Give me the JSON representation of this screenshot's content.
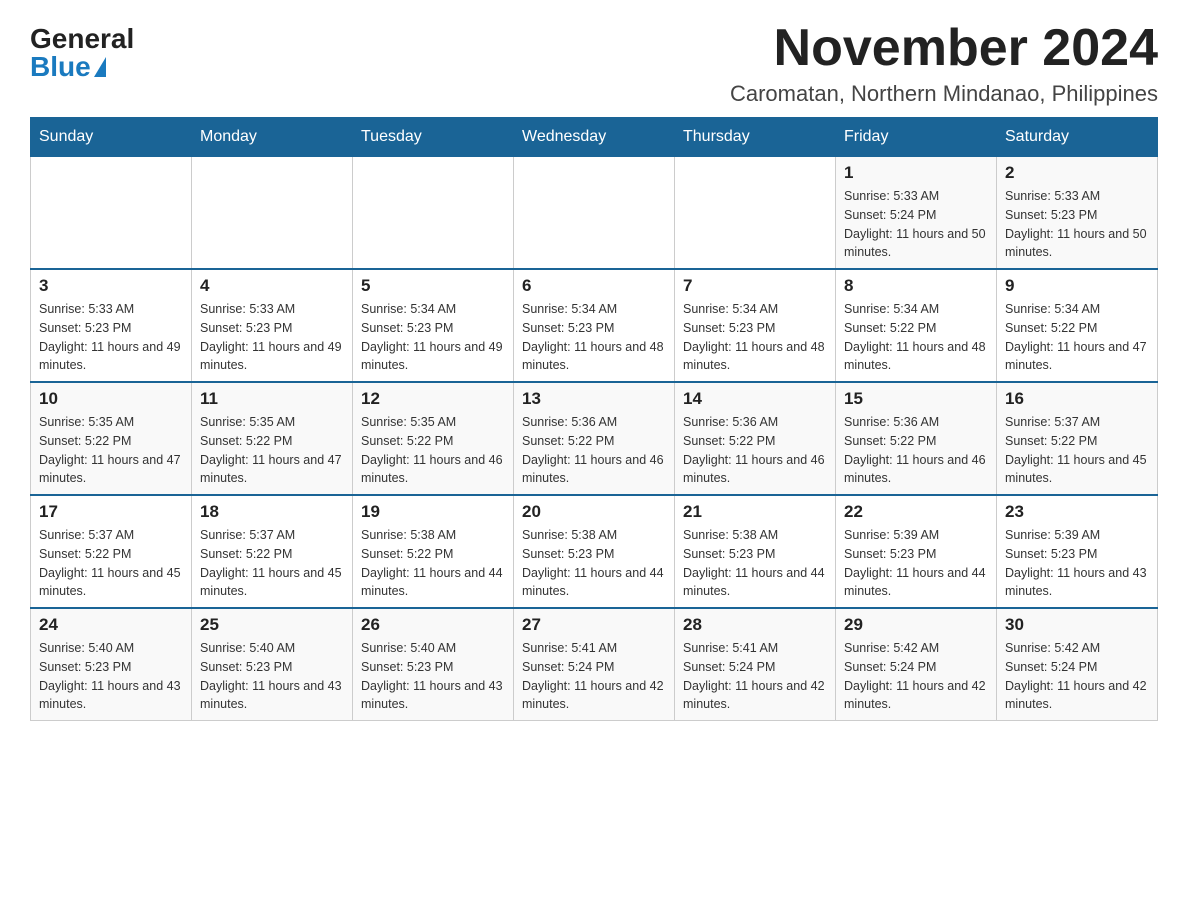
{
  "header": {
    "logo_general": "General",
    "logo_blue": "Blue",
    "month_year": "November 2024",
    "location": "Caromatan, Northern Mindanao, Philippines"
  },
  "days_of_week": [
    "Sunday",
    "Monday",
    "Tuesday",
    "Wednesday",
    "Thursday",
    "Friday",
    "Saturday"
  ],
  "weeks": [
    [
      {
        "day": "",
        "info": ""
      },
      {
        "day": "",
        "info": ""
      },
      {
        "day": "",
        "info": ""
      },
      {
        "day": "",
        "info": ""
      },
      {
        "day": "",
        "info": ""
      },
      {
        "day": "1",
        "info": "Sunrise: 5:33 AM\nSunset: 5:24 PM\nDaylight: 11 hours and 50 minutes."
      },
      {
        "day": "2",
        "info": "Sunrise: 5:33 AM\nSunset: 5:23 PM\nDaylight: 11 hours and 50 minutes."
      }
    ],
    [
      {
        "day": "3",
        "info": "Sunrise: 5:33 AM\nSunset: 5:23 PM\nDaylight: 11 hours and 49 minutes."
      },
      {
        "day": "4",
        "info": "Sunrise: 5:33 AM\nSunset: 5:23 PM\nDaylight: 11 hours and 49 minutes."
      },
      {
        "day": "5",
        "info": "Sunrise: 5:34 AM\nSunset: 5:23 PM\nDaylight: 11 hours and 49 minutes."
      },
      {
        "day": "6",
        "info": "Sunrise: 5:34 AM\nSunset: 5:23 PM\nDaylight: 11 hours and 48 minutes."
      },
      {
        "day": "7",
        "info": "Sunrise: 5:34 AM\nSunset: 5:23 PM\nDaylight: 11 hours and 48 minutes."
      },
      {
        "day": "8",
        "info": "Sunrise: 5:34 AM\nSunset: 5:22 PM\nDaylight: 11 hours and 48 minutes."
      },
      {
        "day": "9",
        "info": "Sunrise: 5:34 AM\nSunset: 5:22 PM\nDaylight: 11 hours and 47 minutes."
      }
    ],
    [
      {
        "day": "10",
        "info": "Sunrise: 5:35 AM\nSunset: 5:22 PM\nDaylight: 11 hours and 47 minutes."
      },
      {
        "day": "11",
        "info": "Sunrise: 5:35 AM\nSunset: 5:22 PM\nDaylight: 11 hours and 47 minutes."
      },
      {
        "day": "12",
        "info": "Sunrise: 5:35 AM\nSunset: 5:22 PM\nDaylight: 11 hours and 46 minutes."
      },
      {
        "day": "13",
        "info": "Sunrise: 5:36 AM\nSunset: 5:22 PM\nDaylight: 11 hours and 46 minutes."
      },
      {
        "day": "14",
        "info": "Sunrise: 5:36 AM\nSunset: 5:22 PM\nDaylight: 11 hours and 46 minutes."
      },
      {
        "day": "15",
        "info": "Sunrise: 5:36 AM\nSunset: 5:22 PM\nDaylight: 11 hours and 46 minutes."
      },
      {
        "day": "16",
        "info": "Sunrise: 5:37 AM\nSunset: 5:22 PM\nDaylight: 11 hours and 45 minutes."
      }
    ],
    [
      {
        "day": "17",
        "info": "Sunrise: 5:37 AM\nSunset: 5:22 PM\nDaylight: 11 hours and 45 minutes."
      },
      {
        "day": "18",
        "info": "Sunrise: 5:37 AM\nSunset: 5:22 PM\nDaylight: 11 hours and 45 minutes."
      },
      {
        "day": "19",
        "info": "Sunrise: 5:38 AM\nSunset: 5:22 PM\nDaylight: 11 hours and 44 minutes."
      },
      {
        "day": "20",
        "info": "Sunrise: 5:38 AM\nSunset: 5:23 PM\nDaylight: 11 hours and 44 minutes."
      },
      {
        "day": "21",
        "info": "Sunrise: 5:38 AM\nSunset: 5:23 PM\nDaylight: 11 hours and 44 minutes."
      },
      {
        "day": "22",
        "info": "Sunrise: 5:39 AM\nSunset: 5:23 PM\nDaylight: 11 hours and 44 minutes."
      },
      {
        "day": "23",
        "info": "Sunrise: 5:39 AM\nSunset: 5:23 PM\nDaylight: 11 hours and 43 minutes."
      }
    ],
    [
      {
        "day": "24",
        "info": "Sunrise: 5:40 AM\nSunset: 5:23 PM\nDaylight: 11 hours and 43 minutes."
      },
      {
        "day": "25",
        "info": "Sunrise: 5:40 AM\nSunset: 5:23 PM\nDaylight: 11 hours and 43 minutes."
      },
      {
        "day": "26",
        "info": "Sunrise: 5:40 AM\nSunset: 5:23 PM\nDaylight: 11 hours and 43 minutes."
      },
      {
        "day": "27",
        "info": "Sunrise: 5:41 AM\nSunset: 5:24 PM\nDaylight: 11 hours and 42 minutes."
      },
      {
        "day": "28",
        "info": "Sunrise: 5:41 AM\nSunset: 5:24 PM\nDaylight: 11 hours and 42 minutes."
      },
      {
        "day": "29",
        "info": "Sunrise: 5:42 AM\nSunset: 5:24 PM\nDaylight: 11 hours and 42 minutes."
      },
      {
        "day": "30",
        "info": "Sunrise: 5:42 AM\nSunset: 5:24 PM\nDaylight: 11 hours and 42 minutes."
      }
    ]
  ]
}
